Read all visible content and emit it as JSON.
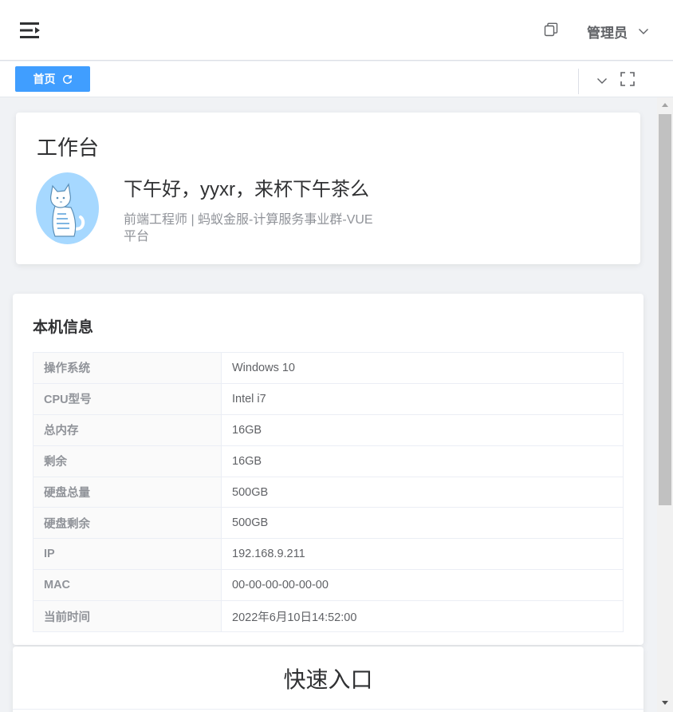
{
  "header": {
    "menu_icon": "menu-fold-icon",
    "copy_icon": "copy-icon",
    "user_name": "管理员"
  },
  "tags": {
    "active_label": "首页",
    "refresh_icon": "refresh-icon",
    "fullscreen_icon": "fullscreen-icon",
    "accent_color": "#409eff"
  },
  "workbench": {
    "title": "工作台",
    "greeting": "下午好，yyxr，来杯下午茶么",
    "job": "前端工程师 | 蚂蚁金服-计算服务事业群-VUE平台"
  },
  "machine_info": {
    "title": "本机信息",
    "rows": [
      {
        "label": "操作系统",
        "value": "Windows 10"
      },
      {
        "label": "CPU型号",
        "value": "Intel i7"
      },
      {
        "label": "总内存",
        "value": "16GB"
      },
      {
        "label": "剩余",
        "value": "16GB"
      },
      {
        "label": "硬盘总量",
        "value": "500GB"
      },
      {
        "label": "硬盘剩余",
        "value": "500GB"
      },
      {
        "label": "IP",
        "value": "192.168.9.211"
      },
      {
        "label": "MAC",
        "value": "00-00-00-00-00-00"
      },
      {
        "label": "当前时间",
        "value": "2022年6月10日14:52:00"
      }
    ]
  },
  "quick_entry": {
    "title": "快速入口"
  }
}
